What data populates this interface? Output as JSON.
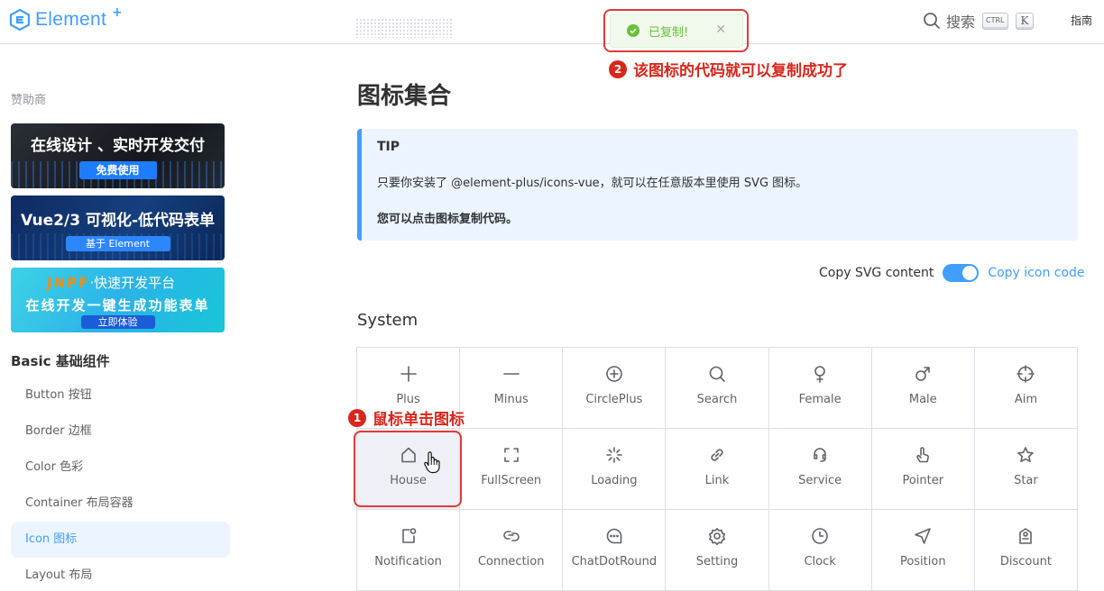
{
  "header": {
    "logo_text": "Element",
    "logo_sup": "+",
    "search_label": "搜索",
    "kbd_ctrl": "CTRL",
    "kbd_k": "K",
    "guide": "指南"
  },
  "toast": {
    "text": "已复制!"
  },
  "annotations": {
    "step1_num": "1",
    "step1": "鼠标单击图标",
    "step2_num": "2",
    "step2": "该图标的代码就可以复制成功了"
  },
  "sidebar": {
    "sponsor_label": "赞助商",
    "banner1": {
      "title": "在线设计 、实时开发交付",
      "button": "免费使用"
    },
    "banner2": {
      "title": "Vue2/3 可视化-低代码表单",
      "button": "基于 Element"
    },
    "banner3": {
      "brand_accent": "JNPF",
      "brand": "·快速开发平台",
      "title": "在线开发一键生成功能表单",
      "button": "立即体验"
    },
    "group": "Basic 基础组件",
    "items": [
      {
        "label": "Button 按钮"
      },
      {
        "label": "Border 边框"
      },
      {
        "label": "Color 色彩"
      },
      {
        "label": "Container 布局容器"
      },
      {
        "label": "Icon 图标"
      },
      {
        "label": "Layout 布局"
      }
    ]
  },
  "main": {
    "title": "图标集合",
    "tip": {
      "title": "TIP",
      "line1": "只要你安装了 @element-plus/icons-vue，就可以在任意版本里使用 SVG 图标。",
      "line2": "您可以点击图标复制代码。"
    },
    "copy_svg": "Copy SVG content",
    "copy_code": "Copy icon code",
    "section": "System",
    "icons": [
      "Plus",
      "Minus",
      "CirclePlus",
      "Search",
      "Female",
      "Male",
      "Aim",
      "House",
      "FullScreen",
      "Loading",
      "Link",
      "Service",
      "Pointer",
      "Star",
      "Notification",
      "Connection",
      "ChatDotRound",
      "Setting",
      "Clock",
      "Position",
      "Discount"
    ]
  },
  "colors": {
    "accent": "#409eff",
    "annotation": "#d9261c",
    "success": "#67c23a"
  }
}
